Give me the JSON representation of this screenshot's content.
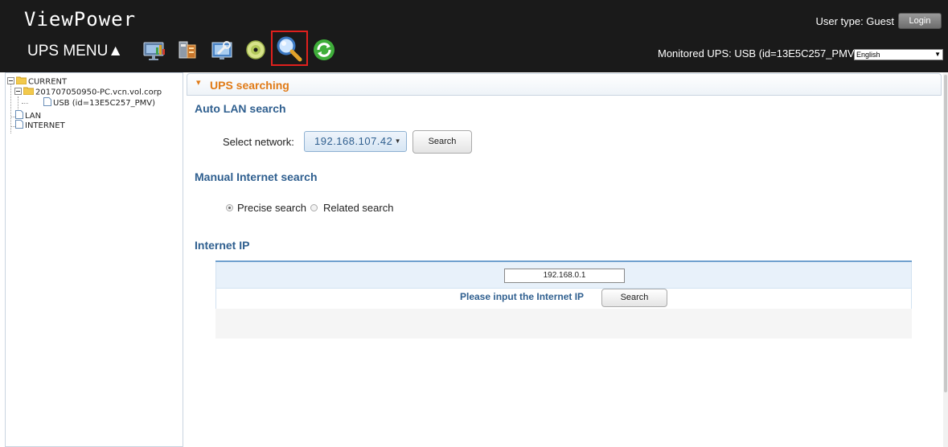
{
  "header": {
    "app_title": "ViewPower",
    "user_type": "User type: Guest",
    "login_label": "Login",
    "menu_label": "UPS MENU▲",
    "monitored_ups": "Monitored UPS: USB (id=13E5C257_PMV)",
    "language": "English",
    "menu_icons": [
      "monitor-chart-icon",
      "battery-config-icon",
      "tools-settings-icon",
      "cd-disc-icon",
      "search-magnifier-icon",
      "refresh-icon"
    ],
    "selected_icon": "search-magnifier-icon"
  },
  "tree": {
    "root": "CURRENT",
    "host": "201707050950-PC.vcn.vol.corp",
    "device": "USB (id=13E5C257_PMV)",
    "lan": "LAN",
    "internet": "INTERNET"
  },
  "panel": {
    "title": "UPS searching"
  },
  "auto_lan": {
    "title": "Auto LAN search",
    "select_label": "Select network:",
    "network_value": "192.168.107.42",
    "search_label": "Search"
  },
  "manual": {
    "title": "Manual Internet search",
    "option_precise": "Precise search",
    "option_related": "Related search",
    "selected": "Precise search"
  },
  "internet_ip": {
    "title": "Internet IP",
    "ip_value": "192.168.0.1",
    "prompt": "Please input the Internet IP",
    "search_label": "Search"
  },
  "colors": {
    "accent_orange": "#e07a16",
    "section_blue": "#2f5f8f",
    "header_bg": "#1a1a1a",
    "selection_red": "#e0201d"
  }
}
